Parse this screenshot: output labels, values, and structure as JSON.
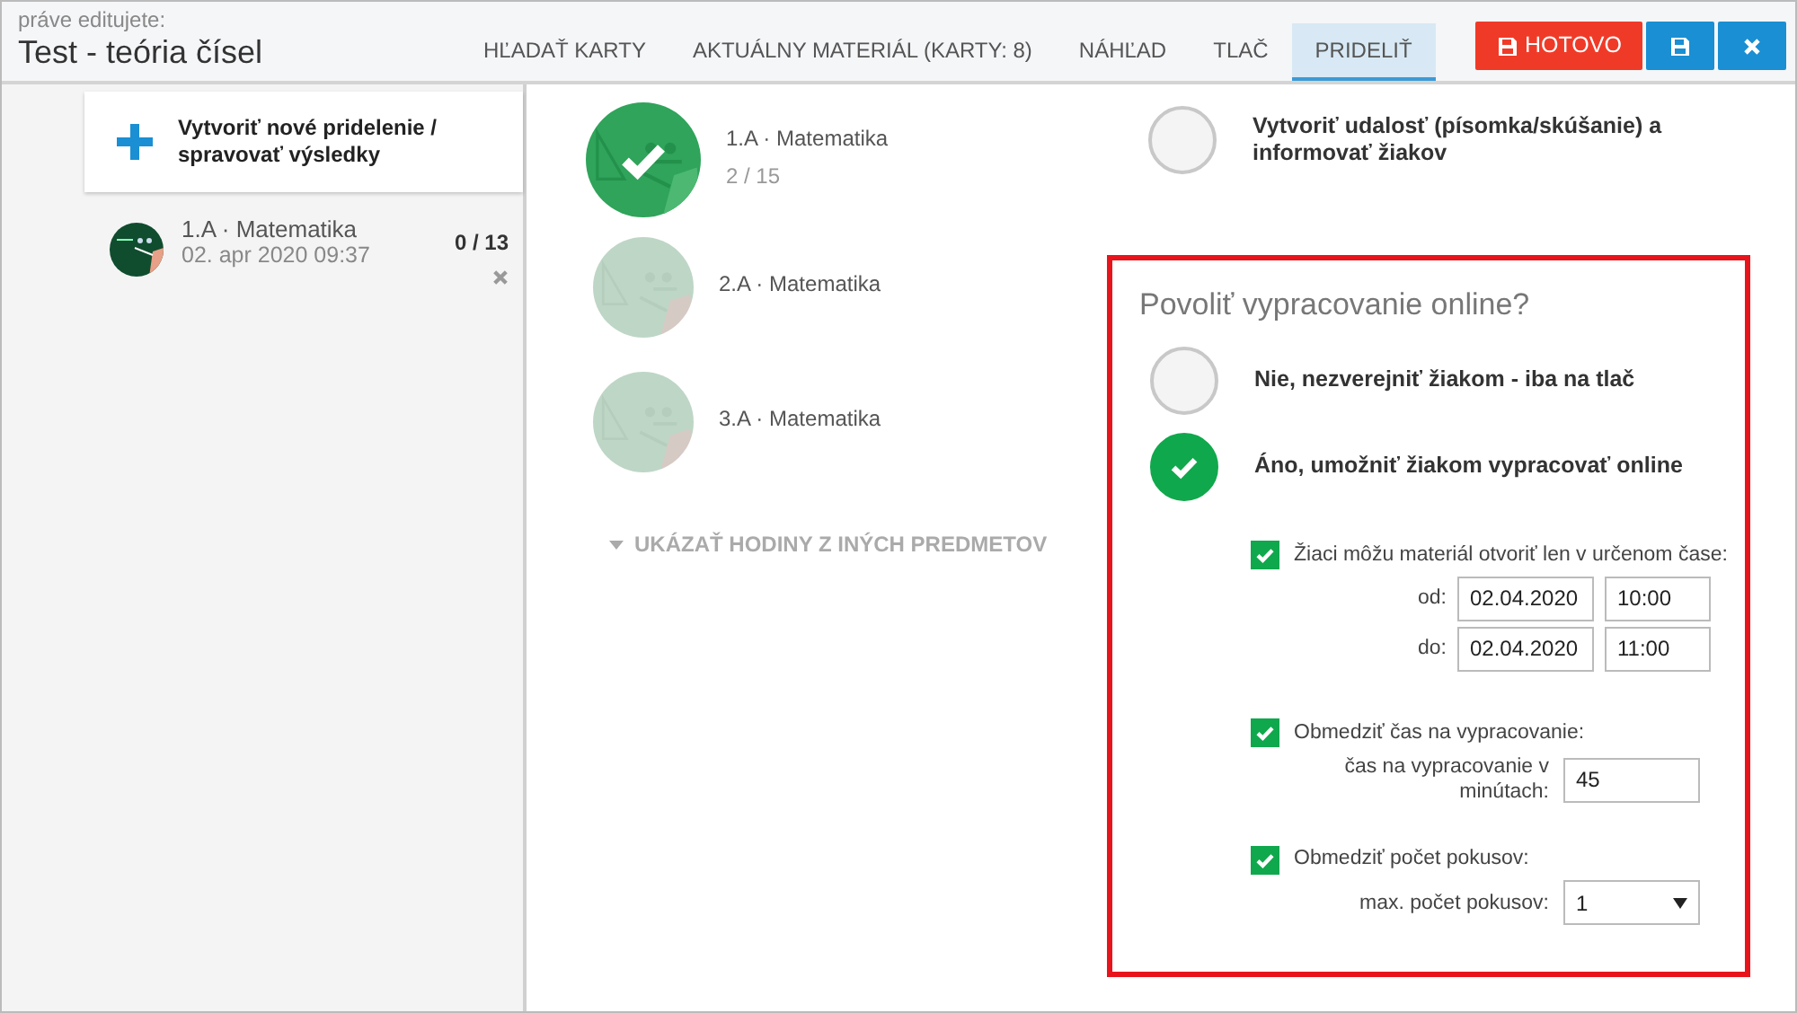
{
  "header": {
    "label": "práve editujete:",
    "title": "Test - teória čísel"
  },
  "tabs": [
    {
      "label": "HĽADAŤ KARTY",
      "selected": false
    },
    {
      "label": "AKTUÁLNY MATERIÁL (KARTY: 8)",
      "selected": false
    },
    {
      "label": "NÁHĽAD",
      "selected": false
    },
    {
      "label": "TLAČ",
      "selected": false
    },
    {
      "label": "PRIDELIŤ",
      "selected": true
    }
  ],
  "buttons": [
    {
      "kind": "done",
      "label": "HOTOVO"
    },
    {
      "kind": "save"
    },
    {
      "kind": "close"
    }
  ],
  "sidebar": {
    "create_label": "Vytvoriť nové pridelenie / spravovať výsledky",
    "assignments": [
      {
        "name": "1.A · Matematika",
        "date": "02. apr 2020 09:37",
        "count": "0 / 13"
      }
    ]
  },
  "classes": [
    {
      "name": "1.A · Matematika",
      "count": "2 / 15",
      "selected": true
    },
    {
      "name": "2.A · Matematika",
      "selected": false
    },
    {
      "name": "3.A · Matematika",
      "selected": false
    }
  ],
  "more_link": "UKÁZAŤ HODINY Z INÝCH PREDMETOV",
  "event_option": {
    "label": "Vytvoriť udalosť (písomka/skúšanie) a informovať žiakov",
    "selected": false
  },
  "online_panel": {
    "title": "Povoliť vypracovanie online?",
    "options": [
      {
        "label": "Nie, nezverejniť žiakom - iba na tlač",
        "selected": false
      },
      {
        "label": "Áno, umožniť žiakom vypracovať online",
        "selected": true
      }
    ],
    "settings": [
      {
        "kind": "time_window",
        "label": "Žiaci môžu materiál otvoriť len v určenom čase:",
        "checked": true,
        "rows": [
          {
            "label": "od:",
            "date": "02.04.2020",
            "time": "10:00"
          },
          {
            "label": "do:",
            "date": "02.04.2020",
            "time": "11:00"
          }
        ]
      },
      {
        "kind": "number",
        "label": "Obmedziť čas na vypracovanie:",
        "checked": true,
        "field_label": "čas na vypracovanie v minútach:",
        "value": "45"
      },
      {
        "kind": "select",
        "label": "Obmedziť počet pokusov:",
        "checked": true,
        "field_label": "max. počet pokusov:",
        "value": "1"
      }
    ]
  }
}
